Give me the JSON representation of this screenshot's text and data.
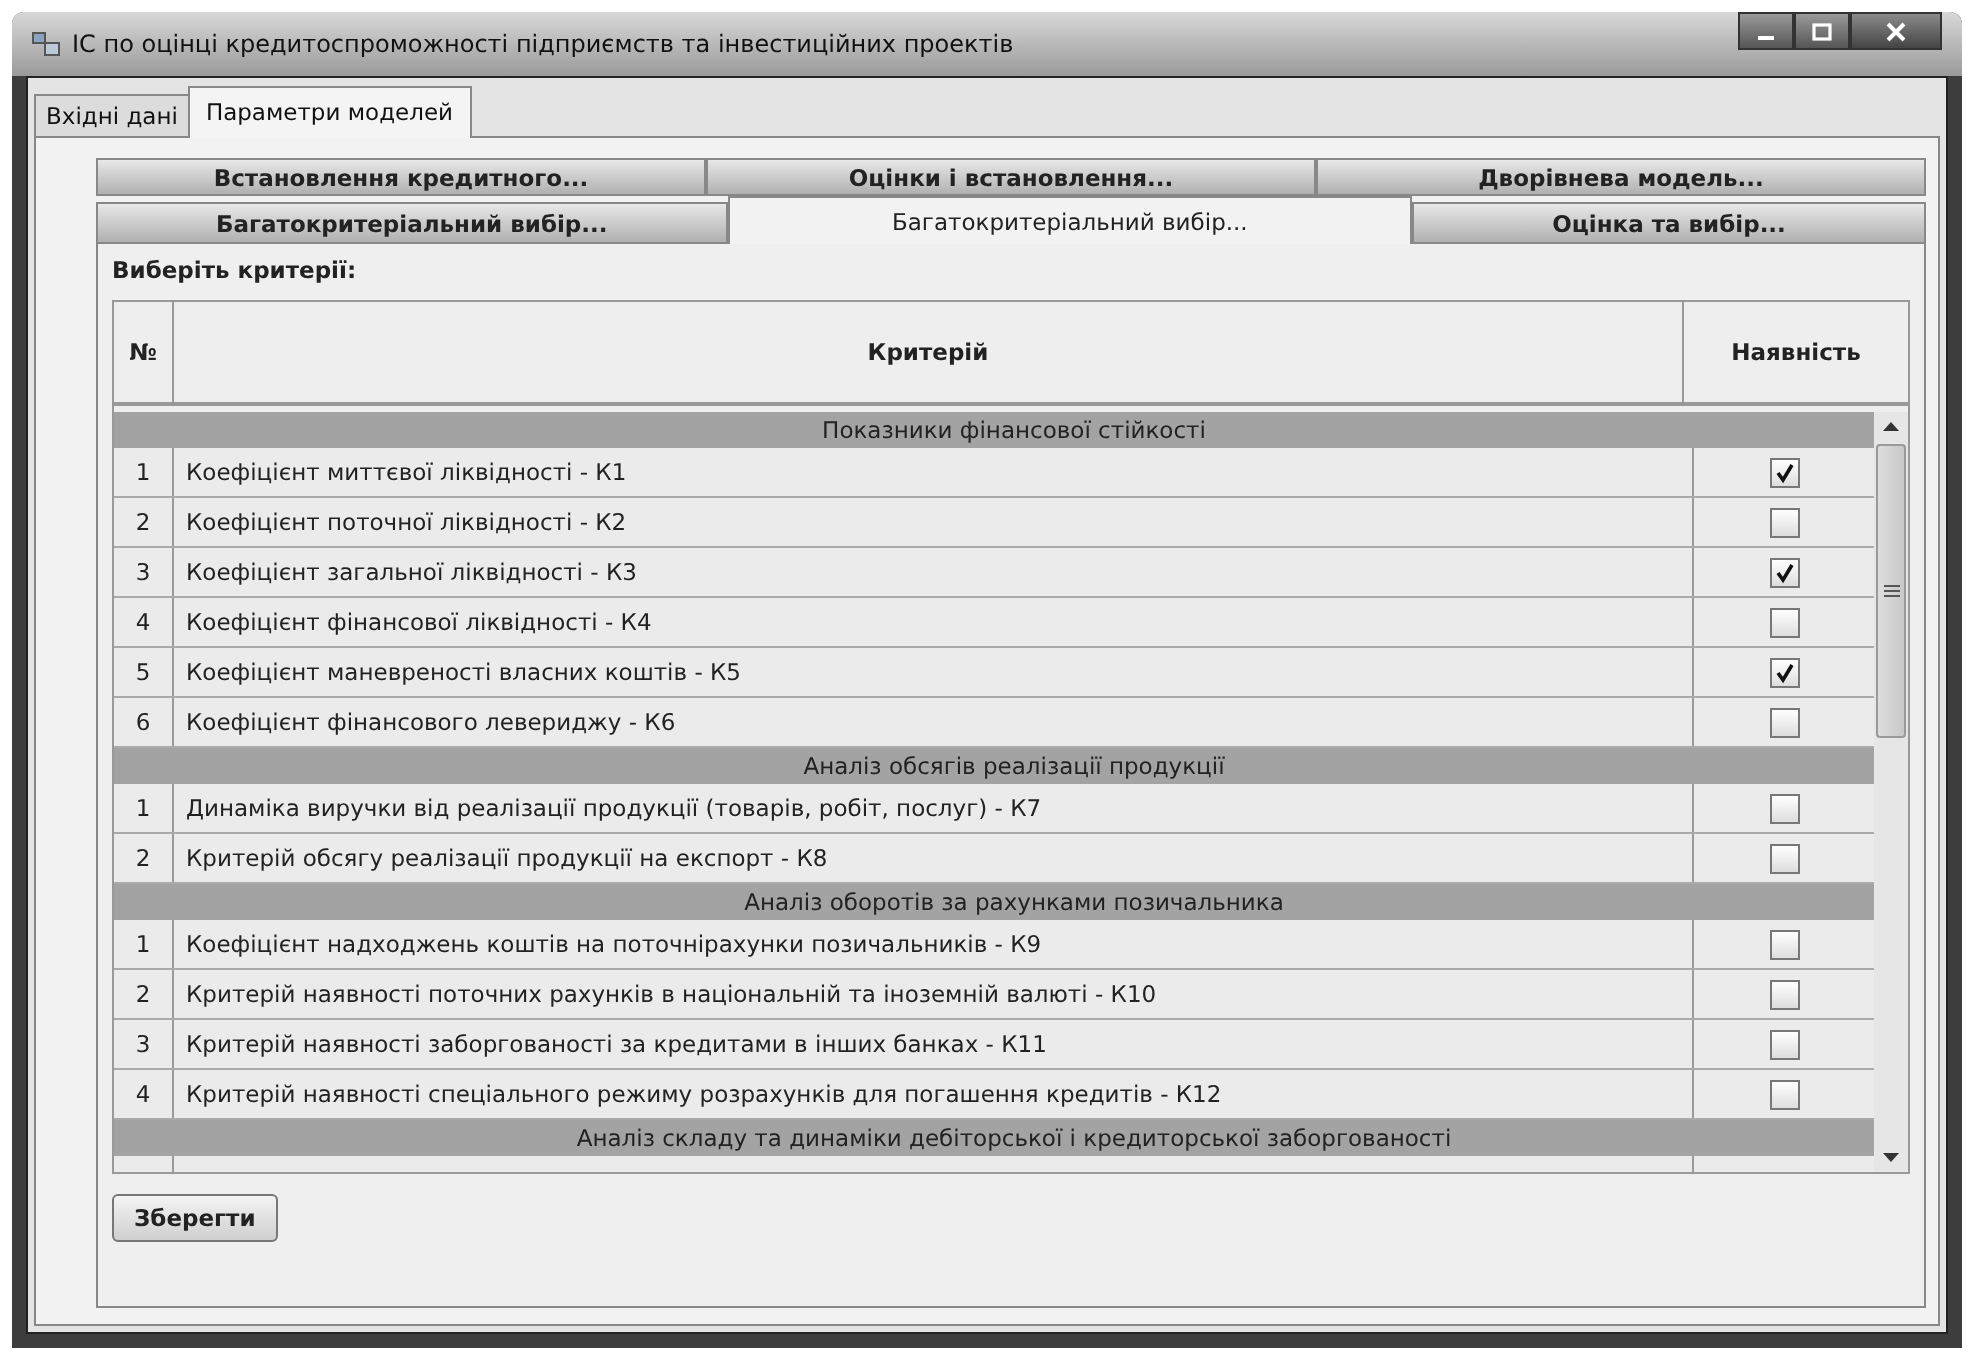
{
  "window": {
    "title": "ІС по оцінці кредитоспроможності підприємств та інвестиційних проектів"
  },
  "main_tabs": [
    {
      "label": "Вхідні дані",
      "selected": false
    },
    {
      "label": "Параметри моделей",
      "selected": true
    }
  ],
  "sub_tab_rows": [
    {
      "tabs": [
        {
          "label": "Встановлення кредитного...",
          "selected": false
        },
        {
          "label": "Оцінки і встановлення...",
          "selected": false
        },
        {
          "label": "Дворівнева модель...",
          "selected": false
        }
      ]
    },
    {
      "tabs": [
        {
          "label": "Багатокритеріальний вибір...",
          "selected": false
        },
        {
          "label": "Багатокритеріальний вибір...",
          "selected": true
        },
        {
          "label": "Оцінка та вибір...",
          "selected": false
        }
      ]
    }
  ],
  "panel": {
    "label": "Виберіть критерії:"
  },
  "table": {
    "columns": [
      "№",
      "Критерій",
      "Наявність"
    ],
    "groups": [
      {
        "title": "Показники фінансової стійкості",
        "rows": [
          {
            "number": "1",
            "criterion": "Коефіцієнт миттєвої ліквідності - К1",
            "present": true
          },
          {
            "number": "2",
            "criterion": "Коефіцієнт поточної ліквідності - К2",
            "present": false
          },
          {
            "number": "3",
            "criterion": "Коефіцієнт загальної ліквідності - К3",
            "present": true
          },
          {
            "number": "4",
            "criterion": "Коефіцієнт фінансової ліквідності - К4",
            "present": false
          },
          {
            "number": "5",
            "criterion": "Коефіцієнт маневреності власних коштів - К5",
            "present": true
          },
          {
            "number": "6",
            "criterion": "Коефіцієнт фінансового левериджу - К6",
            "present": false
          }
        ]
      },
      {
        "title": "Аналіз обсягів реалізації продукції",
        "rows": [
          {
            "number": "1",
            "criterion": "Динаміка виручки від реалізації продукції (товарів, робіт, послуг) - К7",
            "present": false
          },
          {
            "number": "2",
            "criterion": "Критерій обсягу реалізації продукції на експорт - К8",
            "present": false
          }
        ]
      },
      {
        "title": "Аналіз оборотів за рахунками позичальника",
        "rows": [
          {
            "number": "1",
            "criterion": "Коефіцієнт надходжень коштів на поточнірахунки позичальників - К9",
            "present": false
          },
          {
            "number": "2",
            "criterion": "Критерій наявності поточних рахунків в національній та іноземній валюті - К10",
            "present": false
          },
          {
            "number": "3",
            "criterion": "Критерій наявності заборгованості за кредитами в інших банках - К11",
            "present": false
          },
          {
            "number": "4",
            "criterion": "Критерій наявності спеціального режиму розрахунків для погашення кредитів - К12",
            "present": false
          }
        ]
      },
      {
        "title": "Аналіз складу та динаміки дебіторської і кредиторської заборгованості"
      }
    ]
  },
  "save_button": "Зберегти"
}
